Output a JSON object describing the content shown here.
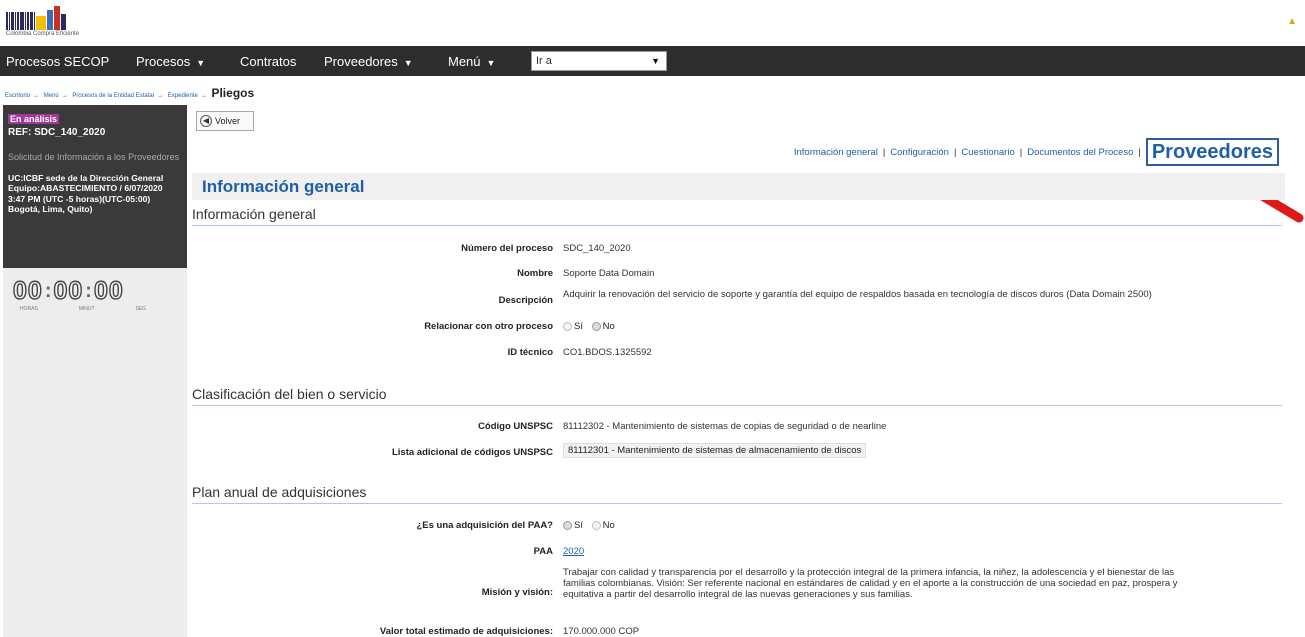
{
  "header": {
    "logo_text": "Colombia Compra Eficiente"
  },
  "navbar": {
    "items": [
      {
        "label": "Procesos SECOP",
        "caret": false
      },
      {
        "label": "Procesos",
        "caret": true
      },
      {
        "label": "Contratos",
        "caret": false
      },
      {
        "label": "Proveedores",
        "caret": true
      },
      {
        "label": "Menú",
        "caret": true
      }
    ],
    "goto_select": {
      "value": "Ir a"
    }
  },
  "breadcrumb": {
    "items": [
      "Escritorio",
      "Menú",
      "Procesos de la Entidad Estatal",
      "Expediente"
    ],
    "current": "Pliegos"
  },
  "left_panel": {
    "status_badge": "En análisis",
    "ref": "REF: SDC_140_2020",
    "description": "Solicitud de Información a los Proveedores",
    "unit_info": "UC:ICBF sede de la Dirección General Equipo:ABASTECIMIENTO / 6/07/2020 3:47 PM (UTC -5 horas)(UTC-05:00) Bogotá, Lima, Quito)",
    "timer": {
      "hours": "00",
      "minutes": "00",
      "seconds": "00",
      "labels": [
        "HORAS",
        "MINUT",
        "SEG"
      ]
    }
  },
  "toolbar": {
    "back_label": "Volver"
  },
  "tabs": {
    "items": [
      "Información general",
      "Configuración",
      "Cuestionario",
      "Documentos del Proceso"
    ],
    "active": "Proveedores"
  },
  "main": {
    "section_title": "Información general",
    "subsections": {
      "general": "Información general",
      "classification": "Clasificación del bien o servicio",
      "plan": "Plan anual de adquisiciones"
    },
    "fields": {
      "process_number": {
        "label": "Número del proceso",
        "value": "SDC_140_2020"
      },
      "name": {
        "label": "Nombre",
        "value": "Soporte Data Domain"
      },
      "description": {
        "label": "Descripción",
        "value": "Adquirir la renovación del servicio de soporte y garantía del equipo de respaldos basada en tecnología de discos duros (Data Domain 2500)"
      },
      "related_process": {
        "label": "Relacionar con otro proceso",
        "options": [
          "Sí",
          "No"
        ],
        "selected": "No"
      },
      "tech_id": {
        "label": "ID técnico",
        "value": "CO1.BDOS.1325592"
      },
      "unspsc_code": {
        "label": "Código UNSPSC",
        "value": "81112302 - Mantenimiento de sistemas de copias de seguridad o de nearline"
      },
      "additional_unspsc": {
        "label": "Lista adicional de códigos UNSPSC",
        "value": "81112301 - Mantenimiento de sistemas de almacenamiento de discos"
      },
      "is_paa": {
        "label": "¿Es una adquisición del PAA?",
        "options": [
          "Sí",
          "No"
        ],
        "selected": "Sí"
      },
      "paa": {
        "label": "PAA",
        "value": "2020"
      },
      "mission": {
        "label": "Misión y visión:",
        "value": "Trabajar con calidad y transparencia por el desarrollo y la protección integral de la primera infancia, la niñez, la adolescencia y el bienestar de las familias colombianas. Visión: Ser referente nacional en estándares de calidad y en el aporte a la construcción de una sociedad en paz, prospera y equitativa a partir del desarrollo integral de las nuevas generaciones y sus familias."
      },
      "total_value": {
        "label": "Valor total estimado de adquisiciones:",
        "value": "170.000.000 COP"
      }
    }
  },
  "colors": {
    "navbar_bg": "#2d2d2d",
    "link_blue": "#1f5fa8",
    "badge_purple": "#a4389a",
    "arrow_red": "#e01818"
  }
}
